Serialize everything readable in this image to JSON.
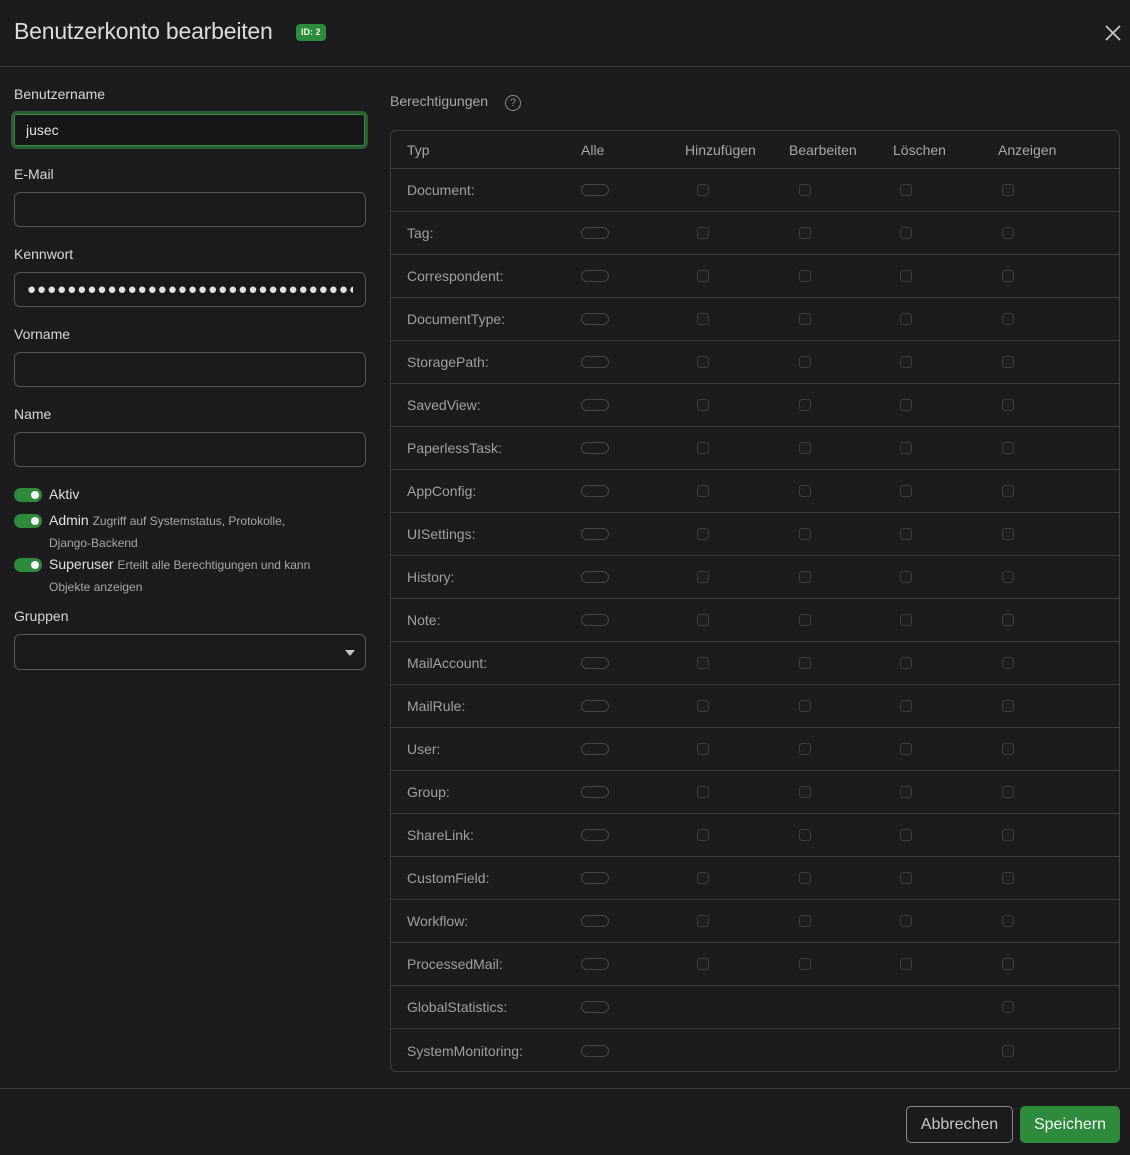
{
  "dialog": {
    "title": "Benutzerkonto bearbeiten",
    "id_badge": "ID: 2",
    "close_icon": "close-icon"
  },
  "form": {
    "username": {
      "label": "Benutzername",
      "value": "jusec"
    },
    "email": {
      "label": "E-Mail",
      "value": ""
    },
    "password": {
      "label": "Kennwort",
      "value": "●●●●●●●●●●●●●●●●●●●●●●●●●●●●●●●●●●●●●●●●●"
    },
    "firstname": {
      "label": "Vorname",
      "value": ""
    },
    "lastname": {
      "label": "Name",
      "value": ""
    },
    "active": {
      "label": "Aktiv",
      "checked": true
    },
    "admin": {
      "label": "Admin",
      "hint": "Zugriff auf Systemstatus, Protokolle, Django-Backend",
      "checked": true
    },
    "superuser": {
      "label": "Superuser",
      "hint": "Erteilt alle Berechtigungen und kann Objekte anzeigen",
      "checked": true
    },
    "groups": {
      "label": "Gruppen",
      "value": ""
    }
  },
  "permissions": {
    "title": "Berechtigungen",
    "help_icon": "?",
    "columns": [
      "Typ",
      "Alle",
      "Hinzufügen",
      "Bearbeiten",
      "Löschen",
      "Anzeigen"
    ],
    "rows": [
      {
        "type": "Document:",
        "full": true
      },
      {
        "type": "Tag:",
        "full": true
      },
      {
        "type": "Correspondent:",
        "full": true
      },
      {
        "type": "DocumentType:",
        "full": true
      },
      {
        "type": "StoragePath:",
        "full": true
      },
      {
        "type": "SavedView:",
        "full": true
      },
      {
        "type": "PaperlessTask:",
        "full": true
      },
      {
        "type": "AppConfig:",
        "full": true
      },
      {
        "type": "UISettings:",
        "full": true
      },
      {
        "type": "History:",
        "full": true
      },
      {
        "type": "Note:",
        "full": true
      },
      {
        "type": "MailAccount:",
        "full": true
      },
      {
        "type": "MailRule:",
        "full": true
      },
      {
        "type": "User:",
        "full": true
      },
      {
        "type": "Group:",
        "full": true
      },
      {
        "type": "ShareLink:",
        "full": true
      },
      {
        "type": "CustomField:",
        "full": true
      },
      {
        "type": "Workflow:",
        "full": true
      },
      {
        "type": "ProcessedMail:",
        "full": true
      },
      {
        "type": "GlobalStatistics:",
        "full": false
      },
      {
        "type": "SystemMonitoring:",
        "full": false
      }
    ]
  },
  "footer": {
    "cancel_label": "Abbrechen",
    "save_label": "Speichern"
  },
  "colors": {
    "accent": "#2e8b3c",
    "background": "#1c1c1e",
    "border": "#3d3d40"
  }
}
